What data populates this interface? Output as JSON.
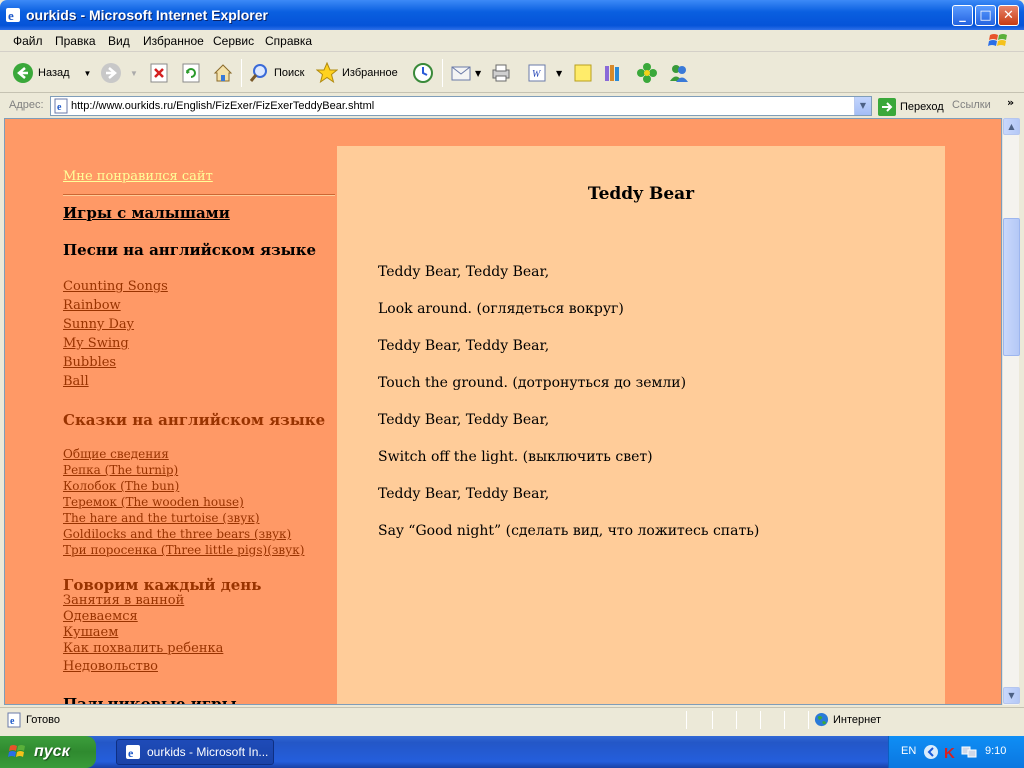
{
  "window": {
    "title": "ourkids - Microsoft Internet Explorer",
    "btn_min": "_",
    "btn_max": "□",
    "btn_close": "✕"
  },
  "menu": [
    "Файл",
    "Правка",
    "Вид",
    "Избранное",
    "Сервис",
    "Справка"
  ],
  "toolbar": {
    "back": "Назад",
    "search": "Поиск",
    "favorites": "Избранное"
  },
  "address": {
    "label": "Адрес:",
    "url": "http://www.ourkids.ru/English/FizExer/FizExerTeddyBear.shtml",
    "go": "Переход",
    "links": "Ссылки"
  },
  "sidebar": {
    "liked": "Мне понравился сайт",
    "games": "Игры с малышами",
    "songs_heading": "Песни на английском языке",
    "songs": [
      "Counting Songs",
      "Rainbow",
      "Sunny Day",
      "My Swing",
      "Bubbles",
      "Ball"
    ],
    "tales_heading": "Сказки на английском языке",
    "tales": [
      "Общие сведения",
      "Репка (The turnip)",
      "Колобок (The bun)",
      "Теремок (The wooden house)",
      "The hare and the turtoise (звук)",
      "Goldilocks and the three bears (звук)",
      "Три поросенка (Three little pigs)(звук)"
    ],
    "daily_heading": "Говорим каждый день",
    "daily": [
      "Занятия в ванной",
      "Одеваемся",
      "Кушаем",
      "Как похвалить ребенка",
      "Недовольство"
    ],
    "finger_heading": "Пальчиковые игры"
  },
  "poem": {
    "title": "Teddy Bear",
    "lines": [
      "Teddy Bear, Teddy Bear,",
      "Look around. (оглядеться вокруг)",
      "Teddy Bear, Teddy Bear,",
      "Touch the ground. (дотронуться до земли)",
      "Teddy Bear, Teddy Bear,",
      "Switch off the light. (выключить свет)",
      "Teddy Bear, Teddy Bear,",
      "Say “Good night” (сделать вид, что ложитесь спать)"
    ]
  },
  "status": {
    "text": "Готово",
    "zone": "Интернет"
  },
  "taskbar": {
    "start": "пуск",
    "task": "ourkids - Microsoft In...",
    "lang": "EN",
    "clock": "9:10"
  }
}
